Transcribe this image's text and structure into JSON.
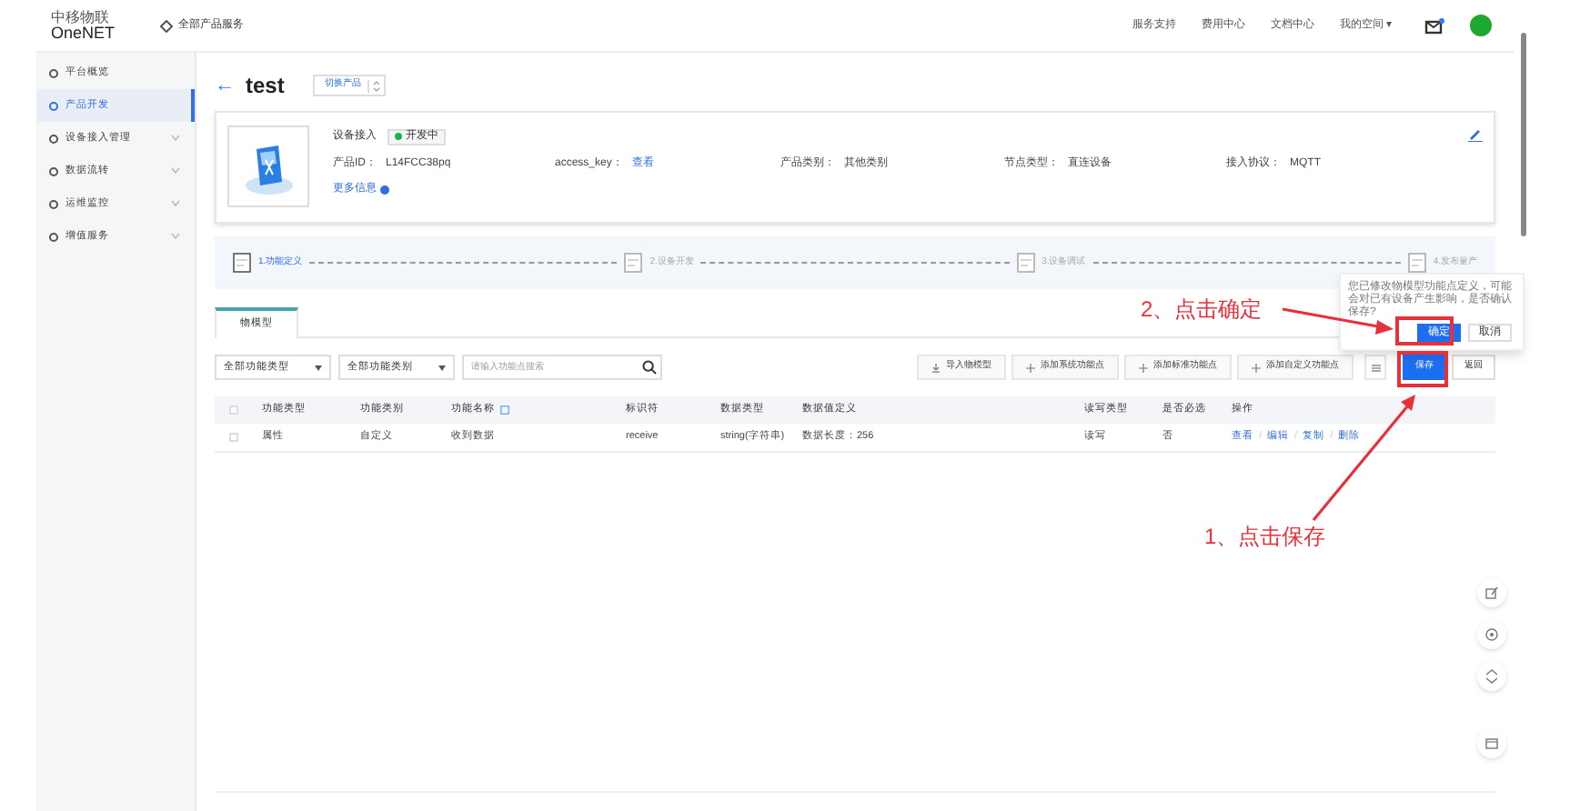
{
  "header": {
    "logo_top": "中移物联",
    "logo_bottom": "OneNET",
    "services": "全部产品服务",
    "links": [
      "服务支持",
      "费用中心",
      "文档中心",
      "我的空间 ▾"
    ],
    "unread": true
  },
  "sidebar": {
    "items": [
      {
        "label": "平台概览",
        "selected": false,
        "expandable": false
      },
      {
        "label": "产品开发",
        "selected": true,
        "expandable": false
      },
      {
        "label": "设备接入管理",
        "selected": false,
        "expandable": true
      },
      {
        "label": "数据流转",
        "selected": false,
        "expandable": true
      },
      {
        "label": "运维监控",
        "selected": false,
        "expandable": true
      },
      {
        "label": "增值服务",
        "selected": false,
        "expandable": true
      }
    ]
  },
  "title": {
    "back": "←",
    "name": "test",
    "switch": "切换产品"
  },
  "product": {
    "name": "设备接入",
    "status": "开发中",
    "fields": [
      {
        "label": "产品ID：",
        "value": "L14FCC38pq",
        "link": false
      },
      {
        "label": "access_key：",
        "value": "查看",
        "link": true
      },
      {
        "label": "产品类别：",
        "value": "其他类别",
        "link": false
      },
      {
        "label": "节点类型：",
        "value": "直连设备",
        "link": false
      },
      {
        "label": "接入协议：",
        "value": "MQTT",
        "link": false
      }
    ],
    "more": "更多信息"
  },
  "steps": [
    {
      "label": "1.功能定义",
      "selected": true
    },
    {
      "label": "2.设备开发",
      "selected": false
    },
    {
      "label": "3.设备调试",
      "selected": false
    },
    {
      "label": "4.发布量产",
      "selected": false
    }
  ],
  "tabs": [
    {
      "label": "物模型",
      "selected": true
    }
  ],
  "filters": {
    "type": "全部功能类型",
    "category": "全部功能类别",
    "placeholder": "请输入功能点搜索"
  },
  "actions": [
    "导入物模型",
    "添加系统功能点",
    "添加标准功能点",
    "添加自定义功能点"
  ],
  "save": "保存",
  "back_button": "返回",
  "table": {
    "header_checked": false,
    "separator": "/",
    "columns": [
      "功能类型",
      "功能类别",
      "功能名称",
      "标识符",
      "数据类型",
      "数据值定义",
      "读写类型",
      "是否必选",
      "操作"
    ],
    "rows": [
      {
        "checked": false,
        "cells": [
          "属性",
          "自定义",
          "收到数据",
          "receive",
          "string(字符串)",
          "数据长度：256",
          "读写",
          "否"
        ],
        "ops": [
          "查看",
          "编辑",
          "复制",
          "删除"
        ]
      }
    ]
  },
  "popover": {
    "message": "您已修改物模型功能点定义，可能会对已有设备产生影响，是否确认保存?",
    "confirm": "确定",
    "cancel": "取消"
  },
  "annotations": [
    {
      "text": "2、点击确定"
    },
    {
      "text": "1、点击保存"
    }
  ]
}
